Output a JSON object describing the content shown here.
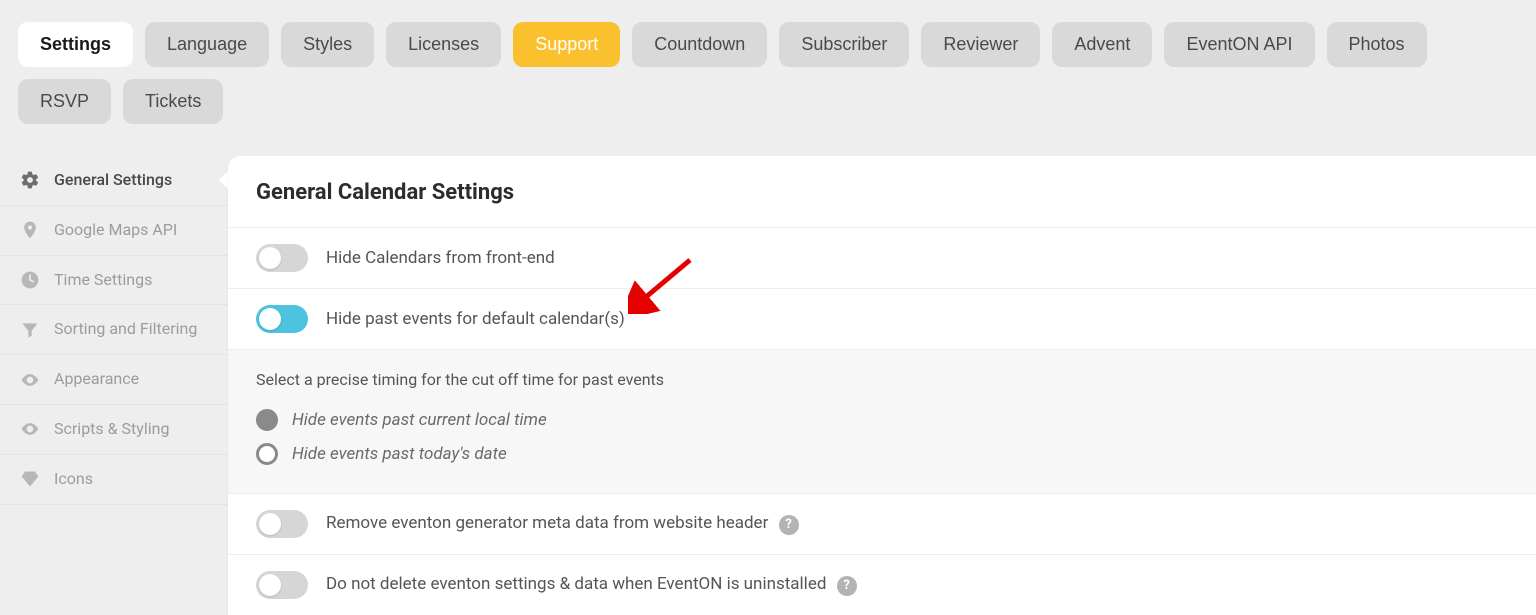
{
  "tabs": [
    {
      "label": "Settings",
      "state": "active"
    },
    {
      "label": "Language",
      "state": ""
    },
    {
      "label": "Styles",
      "state": ""
    },
    {
      "label": "Licenses",
      "state": ""
    },
    {
      "label": "Support",
      "state": "highlight"
    },
    {
      "label": "Countdown",
      "state": ""
    },
    {
      "label": "Subscriber",
      "state": ""
    },
    {
      "label": "Reviewer",
      "state": ""
    },
    {
      "label": "Advent",
      "state": ""
    },
    {
      "label": "EventON API",
      "state": ""
    },
    {
      "label": "Photos",
      "state": ""
    },
    {
      "label": "RSVP",
      "state": ""
    },
    {
      "label": "Tickets",
      "state": ""
    }
  ],
  "sidebar": {
    "items": [
      {
        "icon": "gear",
        "label": "General Settings",
        "active": true
      },
      {
        "icon": "pin",
        "label": "Google Maps API",
        "active": false
      },
      {
        "icon": "clock",
        "label": "Time Settings",
        "active": false
      },
      {
        "icon": "filter",
        "label": "Sorting and Filtering",
        "active": false
      },
      {
        "icon": "eye",
        "label": "Appearance",
        "active": false
      },
      {
        "icon": "eye",
        "label": "Scripts & Styling",
        "active": false
      },
      {
        "icon": "diamond",
        "label": "Icons",
        "active": false
      }
    ]
  },
  "main": {
    "title": "General Calendar Settings",
    "toggles": {
      "hide_calendars": {
        "label": "Hide Calendars from front-end",
        "on": false
      },
      "hide_past": {
        "label": "Hide past events for default calendar(s)",
        "on": true
      },
      "remove_meta": {
        "label": "Remove eventon generator meta data from website header",
        "on": false,
        "help": "?"
      },
      "keep_data": {
        "label": "Do not delete eventon settings & data when EventON is uninstalled",
        "on": false,
        "help": "?"
      }
    },
    "past_cutoff": {
      "heading": "Select a precise timing for the cut off time for past events",
      "options": [
        {
          "label": "Hide events past current local time",
          "selected": true
        },
        {
          "label": "Hide events past today's date",
          "selected": false
        }
      ]
    }
  }
}
